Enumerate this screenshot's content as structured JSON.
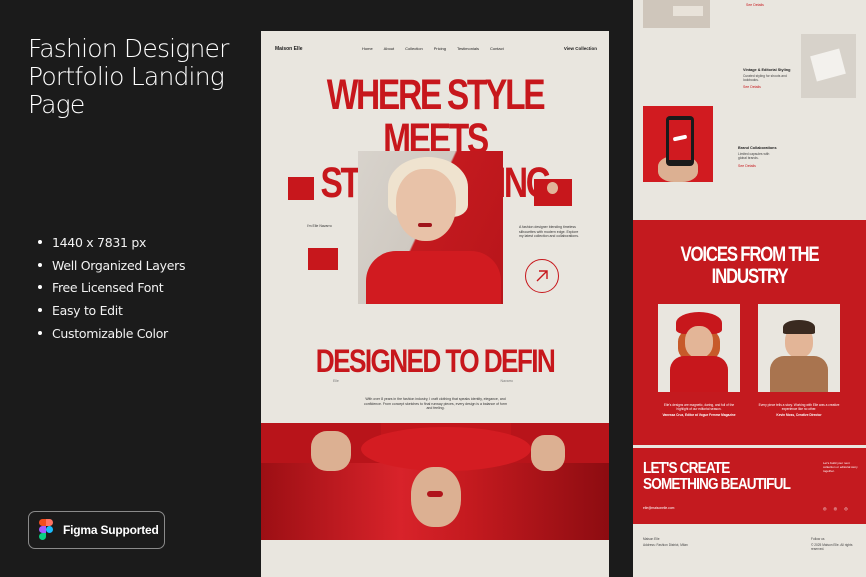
{
  "promo": {
    "title": "Fashion Designer Portfolio Landing Page",
    "features": [
      "1440 x 7831 px",
      "Well Organized Layers",
      "Free Licensed Font",
      "Easy to Edit",
      "Customizable Color"
    ],
    "badge_label": "Figma Supported",
    "icon": "figma-icon"
  },
  "mockup": {
    "brand": "Maison Elle",
    "nav": [
      "Home",
      "About",
      "Collection",
      "Pricing",
      "Testimonials",
      "Contact"
    ],
    "cta": "View Collection",
    "headline_line1": "WHERE STYLE",
    "headline_line2": "MEETS STORYTELLING",
    "hero_name": "I'm Elle Navarro",
    "hero_desc": "A fashion designer blending timeless silhouettes with modern edge. Explore my latest collection and collaborations.",
    "designed": "DESIGNED TO DEFIN",
    "designed_sub": [
      "Elle",
      "Navarro"
    ],
    "designed_sub_left": "Elle",
    "designed_desc": "With over 8 years in the fashion industry, I craft clothing that speaks identity, elegance, and confidence. From concept sketches to final runway pieces, every design is a balance of form and feeling."
  },
  "right": {
    "link_see": "See Details",
    "item1_head": "Vintage & Editorial Styling",
    "item1_text": "Curated styling for shoots and lookbooks.",
    "item2_head": "Brand Collaborations",
    "item2_text": "Limited capsules with global brands.",
    "voices_title_1": "VOICES FROM THE",
    "voices_title_2": "INDUSTRY",
    "quote1": "Elle's designs are magnetic, daring, and full of the highlight of our editorial season.",
    "author1": "Vanessa Cruz, Editor at Vogue Femme Magazine",
    "quote2": "Every piece tells a story. Working with Elle was a creative experience like no other.",
    "author2": "Kevin Moss, Creative Director",
    "create_1": "LET'S CREATE",
    "create_2": "SOMETHING BEAUTIFUL",
    "create_side": "Let's build your next collection or editorial story together.",
    "email": "elle@maisonelle.com",
    "social": "◎ ◎ ◎",
    "foot_left_1": "Maison Elle",
    "foot_left_2": "Address: Fashion District, Milan",
    "foot_right_1": "Follow us",
    "foot_right_2": "© 2025 Maison Elle. All rights reserved."
  },
  "colors": {
    "accent": "#c7171c",
    "bg_dark": "#1b1b1b",
    "paper": "#e9e6df"
  }
}
